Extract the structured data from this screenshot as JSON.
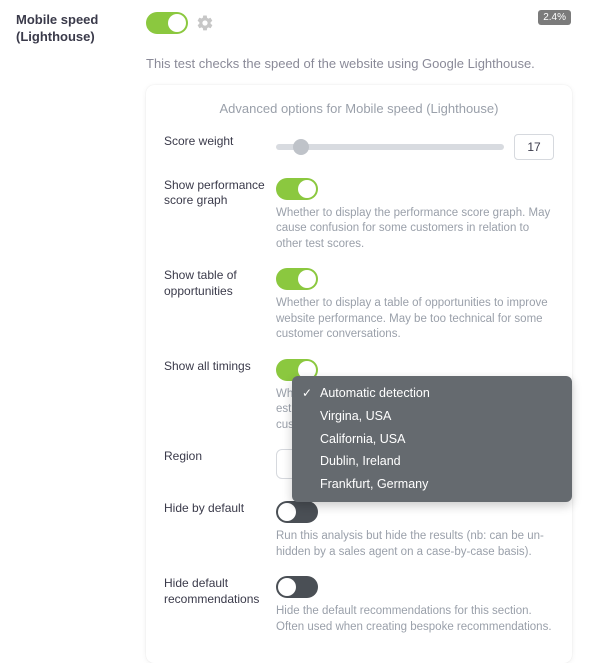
{
  "header": {
    "title": "Mobile speed\n(Lighthouse)",
    "badge": "2.4%",
    "description": "This test checks the speed of the website using Google Lighthouse."
  },
  "card": {
    "title": "Advanced options for Mobile speed (Lighthouse)"
  },
  "score_weight": {
    "label": "Score weight",
    "value": "17"
  },
  "perf_graph": {
    "label": "Show performance score graph",
    "desc": "Whether to display the performance score graph. May cause confusion for some customers in relation to other test scores."
  },
  "opportunities": {
    "label": "Show table of opportunities",
    "desc": "Whether to display a table of opportunities to improve website performance. May be too technical for some customer conversations."
  },
  "timings": {
    "label": "Show all timings",
    "desc": "Whether to display speed index, first CPU idle and estimated input latency. May be too technical for some customer conversations."
  },
  "region": {
    "label": "Region",
    "options": [
      "Automatic detection",
      "Virgina, USA",
      "California, USA",
      "Dublin, Ireland",
      "Frankfurt, Germany"
    ]
  },
  "hide_default": {
    "label": "Hide by default",
    "desc": "Run this analysis but hide the results (nb: can be un-hidden by a sales agent on a case-by-case basis)."
  },
  "hide_recs": {
    "label": "Hide default recommendations",
    "desc": "Hide the default recommendations for this section. Often used when creating bespoke recommendations."
  }
}
